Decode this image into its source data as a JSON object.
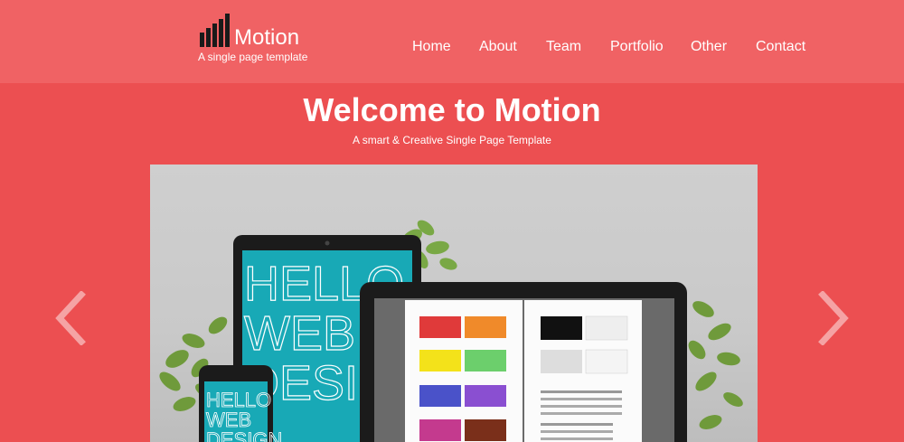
{
  "brand": {
    "name": "Motion",
    "tagline": "A single page template"
  },
  "nav": {
    "items": [
      "Home",
      "About",
      "Team",
      "Portfolio",
      "Other",
      "Contact"
    ]
  },
  "hero": {
    "title": "Welcome to Motion",
    "subtitle": "A smart & Creative Single Page Template"
  },
  "slider": {
    "prev_icon": "chevron-left-icon",
    "next_icon": "chevron-right-icon",
    "slide": {
      "tablet_text": [
        "HELLO",
        "WEB",
        "DESIG"
      ],
      "phone_text": [
        "HELLO",
        "WEB",
        "DESIGN"
      ]
    }
  },
  "colors": {
    "header_bg": "#f06264",
    "page_bg": "#ec4f51",
    "accent_teal": "#18a9b6"
  }
}
